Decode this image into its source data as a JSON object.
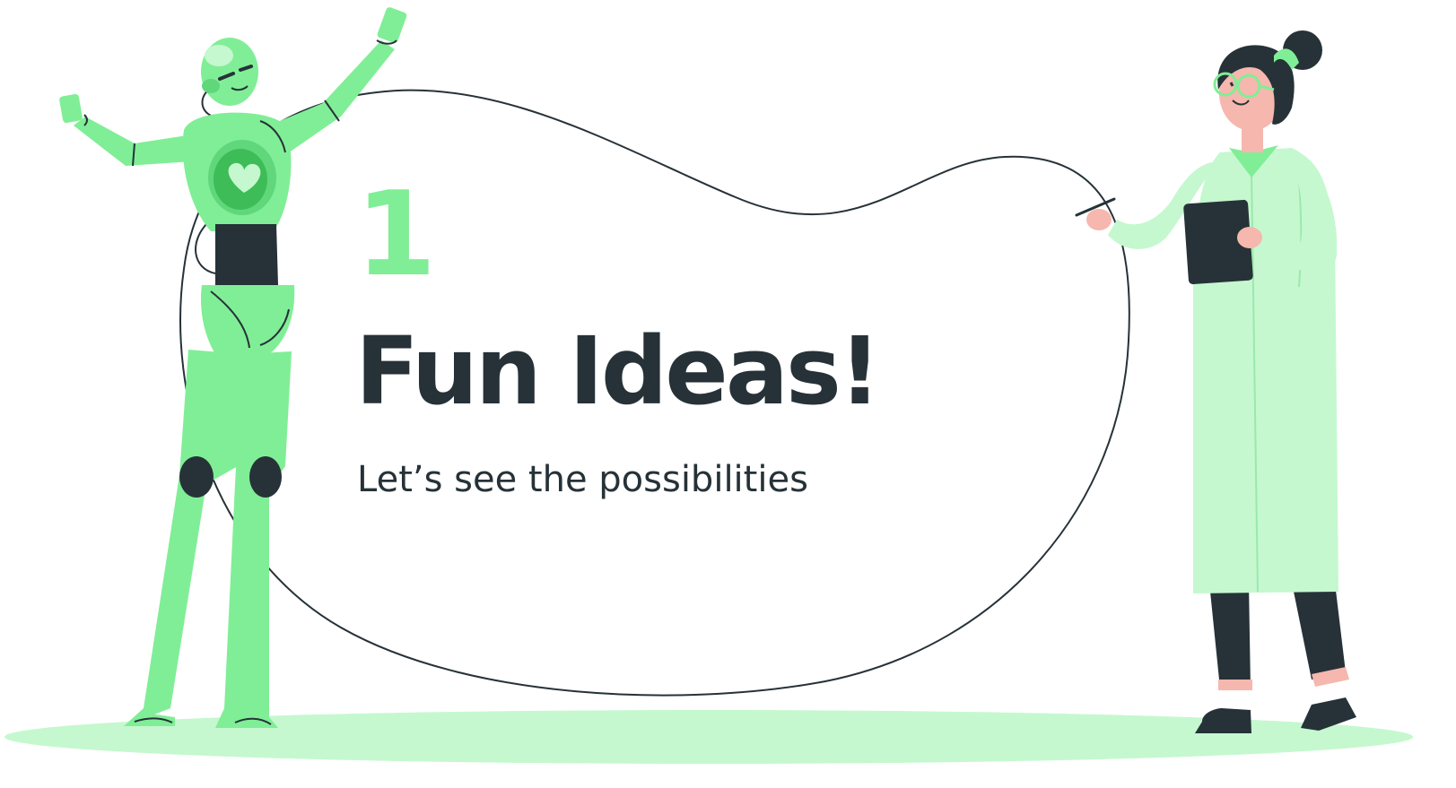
{
  "slide": {
    "number": "1",
    "title": "Fun Ideas!",
    "subtitle": "Let’s see the possibilities"
  },
  "colors": {
    "accent_green": "#80ee96",
    "dark_text": "#263238",
    "light_green": "#c5f8cf",
    "pale_green": "#b8f5c4",
    "skin": "#f6b7ae",
    "deep_green": "#3dbc57"
  },
  "icons": {
    "robot": "robot-illustration",
    "scientist": "scientist-illustration",
    "heart": "heart-icon"
  }
}
